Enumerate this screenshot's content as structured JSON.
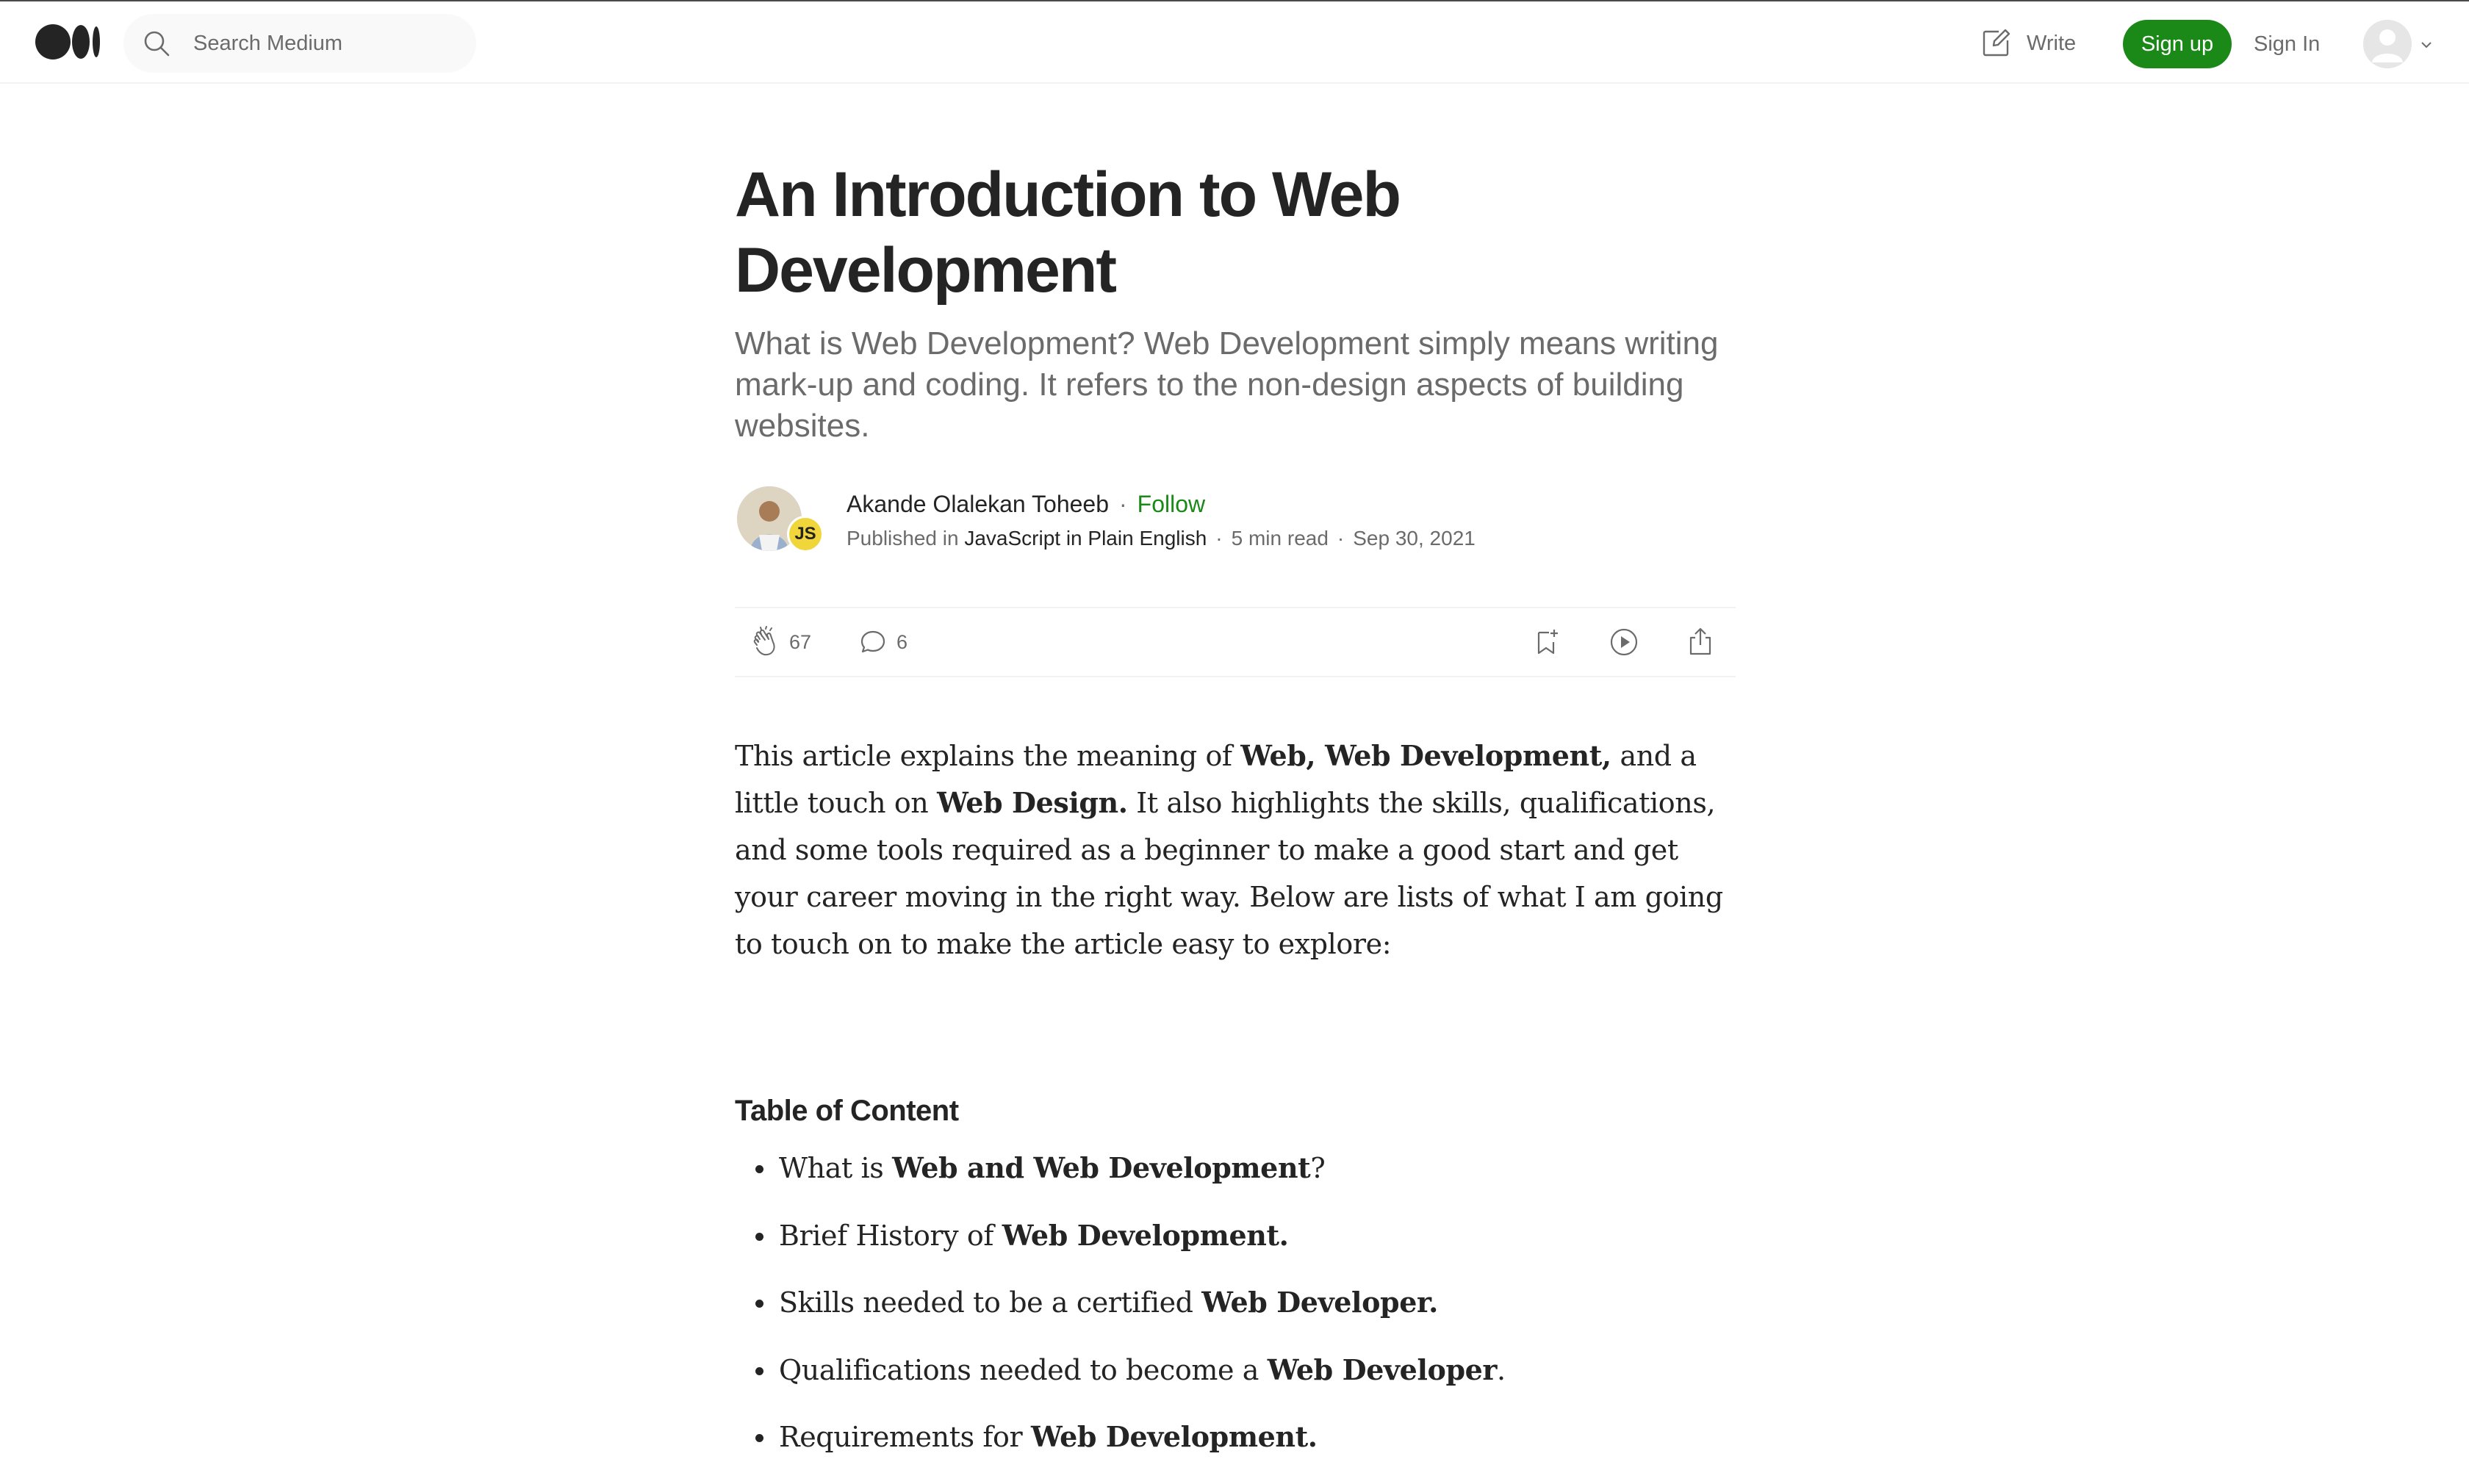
{
  "header": {
    "logo": "medium-logo",
    "search_placeholder": "Search Medium",
    "write_label": "Write",
    "signup_label": "Sign up",
    "signin_label": "Sign In"
  },
  "article": {
    "title": "An Introduction to Web Development",
    "subtitle": "What is Web Development? Web Development simply means writing mark-up and coding. It refers to the non-design aspects of building websites.",
    "author": {
      "name": "Akande Olalekan Toheeb",
      "follow_label": "Follow",
      "published_in_label": "Published in",
      "publication": "JavaScript in Plain English",
      "publication_badge": "JS",
      "read_time": "5 min read",
      "date": "Sep 30, 2021"
    },
    "stats": {
      "claps": "67",
      "responses": "6"
    },
    "intro": {
      "t1": "This article explains the meaning of ",
      "b1": "Web, Web Development,",
      "t2": " and a little touch on ",
      "b2": "Web Design.",
      "t3": " It also highlights the skills, qualifications, and some tools required as a beginner to make a good start and get your career moving in the right way. Below are lists of what I am going to touch on to make the article easy to explore:"
    },
    "toc_title": "Table of Content",
    "toc": [
      {
        "pre": "What is ",
        "bold": "Web and Web Development",
        "post": "?"
      },
      {
        "pre": "Brief History of ",
        "bold": "Web Development.",
        "post": ""
      },
      {
        "pre": "Skills needed to be a certified ",
        "bold": "Web Developer.",
        "post": ""
      },
      {
        "pre": "Qualifications needed to become a ",
        "bold": "Web Developer",
        "post": "."
      },
      {
        "pre": "Requirements for ",
        "bold": "Web Development.",
        "post": ""
      }
    ]
  },
  "colors": {
    "accent": "#1a8917",
    "text": "#242424",
    "muted": "#6b6b6b"
  }
}
